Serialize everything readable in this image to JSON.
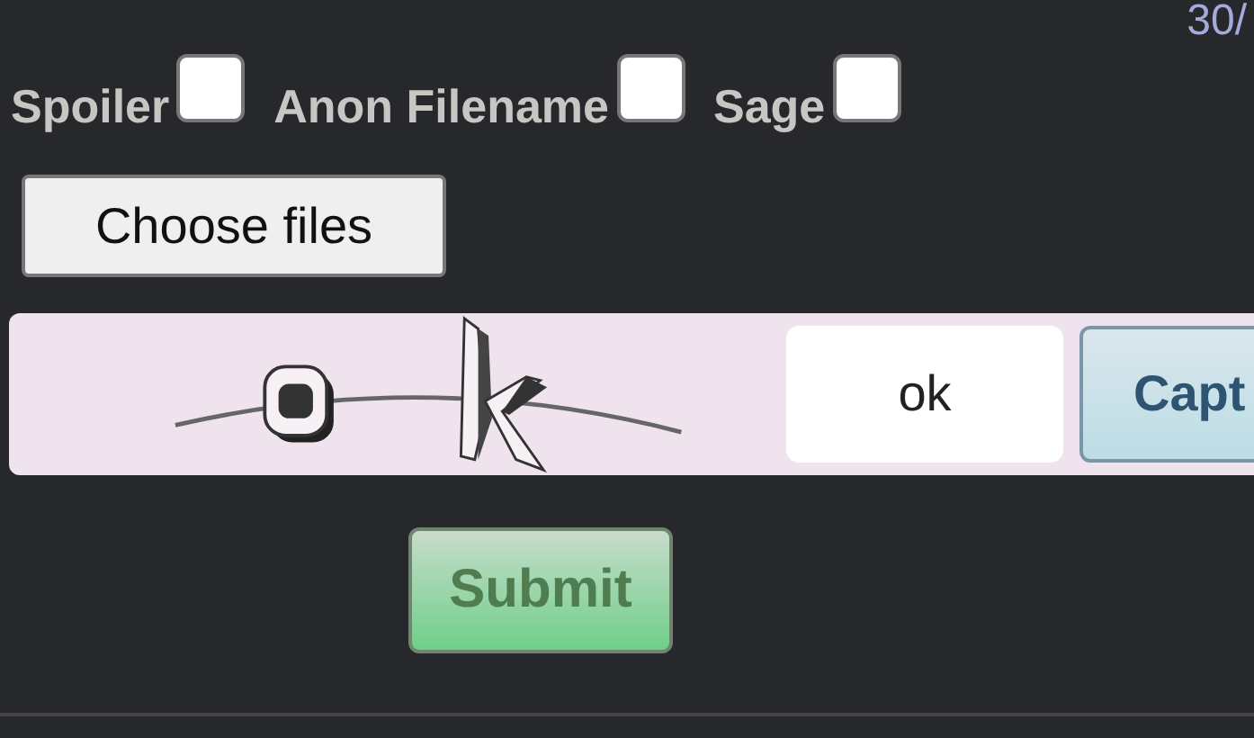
{
  "counter": "30/",
  "options": [
    {
      "label": "Spoiler",
      "checked": false
    },
    {
      "label": "Anon Filename",
      "checked": false
    },
    {
      "label": "Sage",
      "checked": false
    }
  ],
  "file_button": "Choose files",
  "captcha": {
    "value": "ok",
    "button": "Capt"
  },
  "submit": "Submit"
}
